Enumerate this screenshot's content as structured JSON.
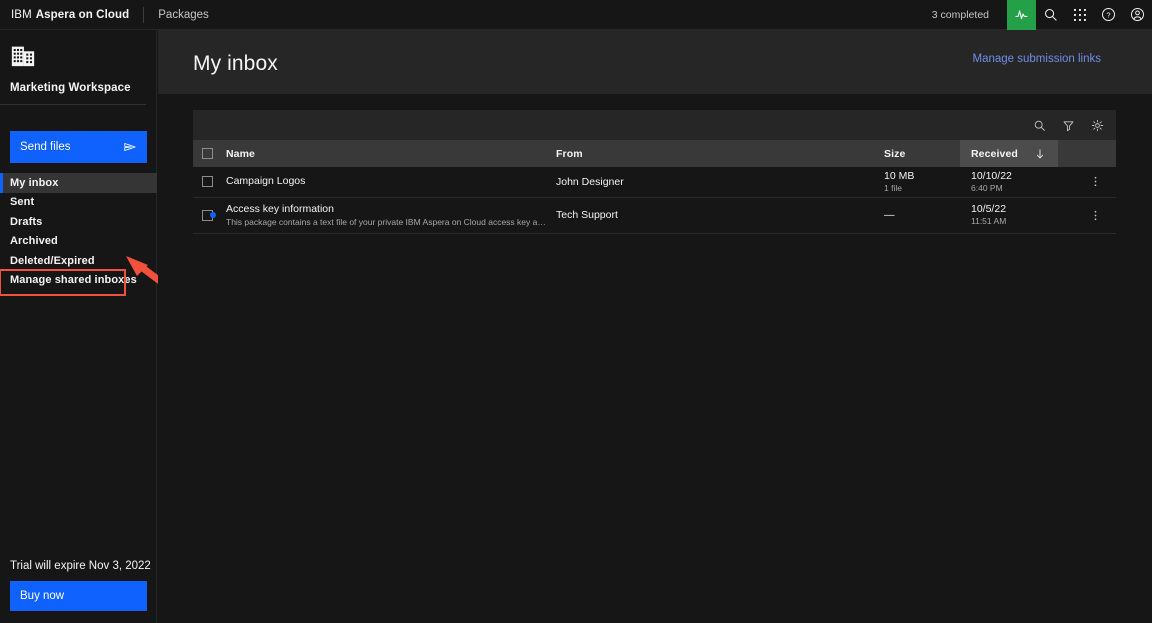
{
  "topbar": {
    "brand_ibm": "IBM",
    "brand_product": "Aspera on Cloud",
    "nav_packages": "Packages",
    "completed_status": "3 completed",
    "icons": {
      "activity": "activity-icon",
      "search": "search-icon",
      "apps": "apps-grid-icon",
      "help": "help-icon",
      "account": "account-icon"
    }
  },
  "sidebar": {
    "workspace_icon": "office-building-icon",
    "workspace_name": "Marketing Workspace",
    "send_files_label": "Send files",
    "send_files_icon": "send-icon",
    "items": [
      {
        "label": "My inbox",
        "selected": true,
        "annotated": false
      },
      {
        "label": "Sent",
        "selected": false,
        "annotated": false
      },
      {
        "label": "Drafts",
        "selected": false,
        "annotated": false
      },
      {
        "label": "Archived",
        "selected": false,
        "annotated": false
      },
      {
        "label": "Deleted/Expired",
        "selected": false,
        "annotated": false
      },
      {
        "label": "Manage shared inboxes",
        "selected": false,
        "annotated": true
      }
    ],
    "trial_text": "Trial will expire Nov 3, 2022",
    "buy_now_label": "Buy now"
  },
  "main": {
    "page_title": "My inbox",
    "head_link": "Manage submission links"
  },
  "toolbar": {
    "search_icon": "search-icon",
    "filter_icon": "filter-funnel-icon",
    "settings_icon": "gear-icon"
  },
  "table": {
    "headers": {
      "name": "Name",
      "from": "From",
      "size": "Size",
      "received": "Received"
    },
    "sort_column": "Received",
    "sort_direction": "descending",
    "rows": [
      {
        "name": "Campaign Logos",
        "description": "",
        "from": "John Designer",
        "size": "10 MB",
        "size_sub": "1 file",
        "received_date": "10/10/22",
        "received_time": "6:40 PM",
        "unread": false
      },
      {
        "name": "Access key information",
        "description": "This package contains a text file of your private IBM Aspera on Cloud access key and s...",
        "from": "Tech Support",
        "size": "—",
        "size_sub": "",
        "received_date": "10/5/22",
        "received_time": "11:51 AM",
        "unread": true
      }
    ]
  },
  "colors": {
    "accent_blue": "#0f62fe",
    "accent_green": "#24a148",
    "annotation_red": "#f4513c",
    "link_blue": "#6f8fe6",
    "bg_dark": "#161616",
    "bg_panel": "#262626",
    "bg_header": "#393939"
  }
}
